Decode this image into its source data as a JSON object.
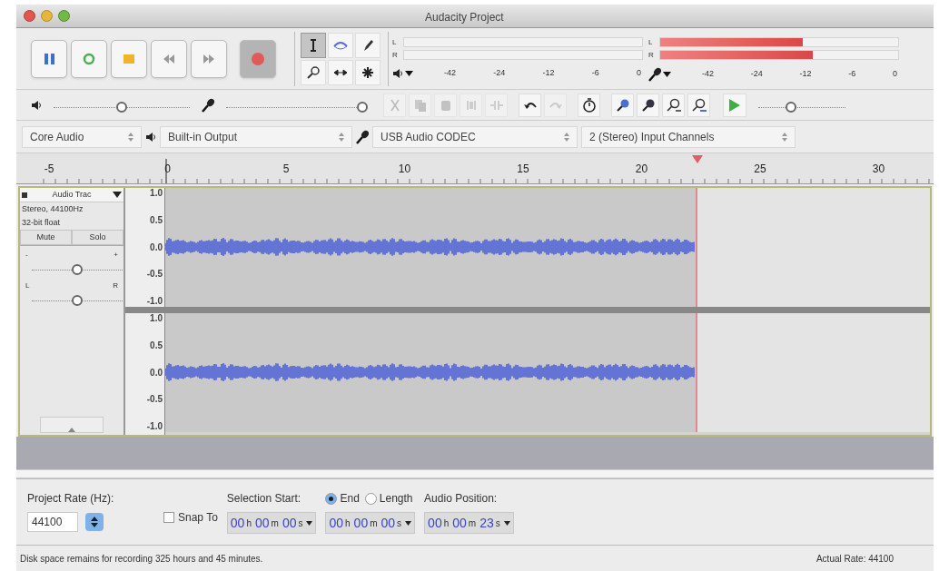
{
  "window": {
    "title": "Audacity Project"
  },
  "transport": [
    {
      "kind": "pause",
      "pressed": false
    },
    {
      "kind": "loop",
      "pressed": false
    },
    {
      "kind": "stop",
      "pressed": false
    },
    {
      "kind": "skip-start",
      "pressed": false
    },
    {
      "kind": "skip-end",
      "pressed": false
    },
    {
      "kind": "record",
      "pressed": true
    }
  ],
  "tools": [
    {
      "kind": "select",
      "selected": true
    },
    {
      "kind": "envelope",
      "selected": false
    },
    {
      "kind": "draw",
      "selected": false
    },
    {
      "kind": "zoom",
      "selected": false
    },
    {
      "kind": "time-shift",
      "selected": false
    },
    {
      "kind": "multi",
      "selected": false
    }
  ],
  "meters": [
    {
      "kind": "playback",
      "channels": [
        {
          "label": "L",
          "level": 0
        },
        {
          "label": "R",
          "level": 0
        }
      ],
      "scale": [
        "-42",
        "-24",
        "-12",
        "-6",
        "0"
      ]
    },
    {
      "kind": "recording",
      "channels": [
        {
          "label": "L",
          "level": 0.6
        },
        {
          "label": "R",
          "level": 0.64
        }
      ],
      "scale": [
        "-42",
        "-24",
        "-12",
        "-6",
        "0"
      ]
    }
  ],
  "mixer": {
    "playback_volume": {
      "level": 0.5
    },
    "recording_volume": {
      "level": 1
    }
  },
  "edit_toolbar": [
    [
      {
        "kind": "cut",
        "disabled": true
      },
      {
        "kind": "copy",
        "disabled": true
      },
      {
        "kind": "paste",
        "disabled": true
      },
      {
        "kind": "trim",
        "disabled": true
      },
      {
        "kind": "silence",
        "disabled": true
      }
    ],
    [
      {
        "kind": "undo",
        "disabled": false
      },
      {
        "kind": "redo",
        "disabled": true
      }
    ],
    [
      {
        "kind": "sync-lock",
        "disabled": false
      }
    ],
    [
      {
        "kind": "zoom-in",
        "disabled": false
      },
      {
        "kind": "zoom-out",
        "disabled": false
      },
      {
        "kind": "fit-selection",
        "disabled": false
      },
      {
        "kind": "fit-project",
        "disabled": false
      }
    ]
  ],
  "play_at_speed": {
    "level": 0.38
  },
  "devices": [
    {
      "kind": "host",
      "value": "Core Audio"
    },
    {
      "kind": "output",
      "value": "Built-in Output"
    },
    {
      "kind": "input",
      "value": "USB Audio CODEC"
    },
    {
      "kind": "channels",
      "value": "2 (Stereo) Input Channels"
    }
  ],
  "ruler": {
    "labels": [
      "-5",
      "0",
      "5",
      "10",
      "15",
      "20",
      "25",
      "30"
    ]
  },
  "track": {
    "name": "Audio Trac",
    "info": [
      "Stereo, 44100Hz",
      "32-bit float"
    ],
    "buttons": [
      "Mute",
      "Solo"
    ],
    "gain": {
      "min_label": "-",
      "max_label": "+",
      "level": 0.5
    },
    "pan": {
      "min_label": "L",
      "max_label": "R",
      "level": 0.5
    },
    "channels": [
      {
        "scale": [
          "1.0",
          "0.5",
          "0.0",
          "-0.5",
          "-1.0"
        ]
      },
      {
        "scale": [
          "1.0",
          "0.5",
          "0.0",
          "-0.5",
          "-1.0"
        ]
      }
    ]
  },
  "selection_bar": {
    "project_rate": {
      "label": "Project Rate (Hz):",
      "value": "44100"
    },
    "snap_to": {
      "label": "Snap To",
      "checked": false
    },
    "selection_start": {
      "label": "Selection Start:",
      "time": [
        {
          "value": "00",
          "unit": "h"
        },
        {
          "value": "00",
          "unit": "m"
        },
        {
          "value": "00",
          "unit": "s"
        }
      ]
    },
    "end_mode": [
      {
        "label": "End",
        "selected": true
      },
      {
        "label": "Length",
        "selected": false
      }
    ],
    "end_time": [
      {
        "value": "00",
        "unit": "h"
      },
      {
        "value": "00",
        "unit": "m"
      },
      {
        "value": "00",
        "unit": "s"
      }
    ],
    "audio_position": {
      "label": "Audio Position:",
      "time": [
        {
          "value": "00",
          "unit": "h"
        },
        {
          "value": "00",
          "unit": "m"
        },
        {
          "value": "23",
          "unit": "s"
        }
      ]
    }
  },
  "status_bar": {
    "message": "Disk space remains for recording 325 hours and 45 minutes.",
    "rate": "Actual Rate: 44100"
  }
}
